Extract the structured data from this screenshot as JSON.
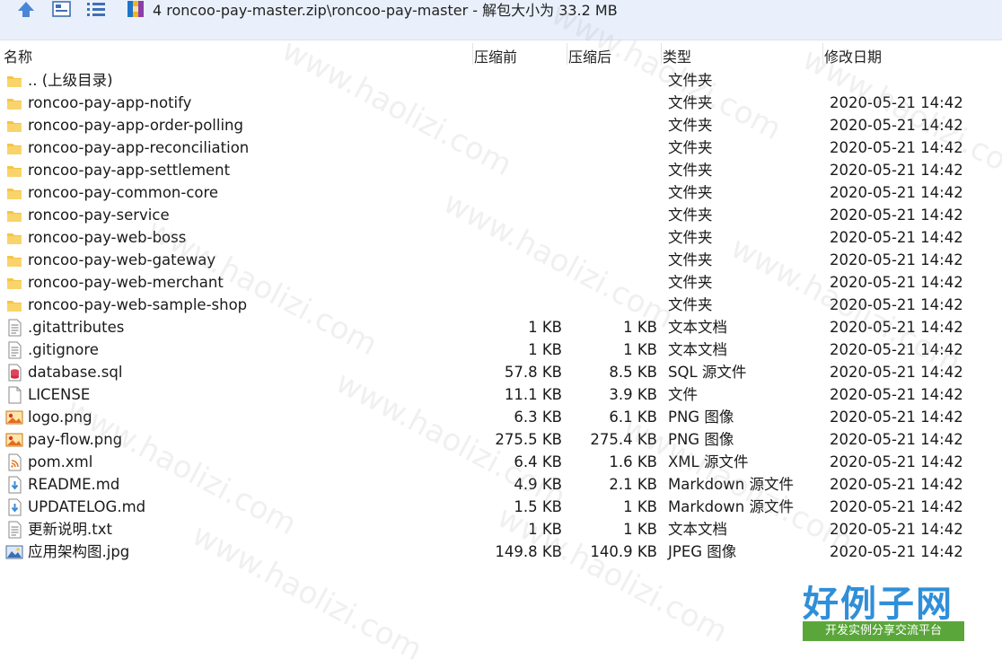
{
  "toolbar": {
    "path": "4 roncoo-pay-master.zip\\roncoo-pay-master - 解包大小为 33.2 MB"
  },
  "columns": {
    "name": "名称",
    "packed": "压缩前",
    "original": "压缩后",
    "type": "类型",
    "modified": "修改日期"
  },
  "files": [
    {
      "icon": "folder-icon",
      "name": ".. (上级目录)",
      "packed": "",
      "original": "",
      "type": "文件夹",
      "modified": ""
    },
    {
      "icon": "folder-icon",
      "name": "roncoo-pay-app-notify",
      "packed": "",
      "original": "",
      "type": "文件夹",
      "modified": "2020-05-21 14:42"
    },
    {
      "icon": "folder-icon",
      "name": "roncoo-pay-app-order-polling",
      "packed": "",
      "original": "",
      "type": "文件夹",
      "modified": "2020-05-21 14:42"
    },
    {
      "icon": "folder-icon",
      "name": "roncoo-pay-app-reconciliation",
      "packed": "",
      "original": "",
      "type": "文件夹",
      "modified": "2020-05-21 14:42"
    },
    {
      "icon": "folder-icon",
      "name": "roncoo-pay-app-settlement",
      "packed": "",
      "original": "",
      "type": "文件夹",
      "modified": "2020-05-21 14:42"
    },
    {
      "icon": "folder-icon",
      "name": "roncoo-pay-common-core",
      "packed": "",
      "original": "",
      "type": "文件夹",
      "modified": "2020-05-21 14:42"
    },
    {
      "icon": "folder-icon",
      "name": "roncoo-pay-service",
      "packed": "",
      "original": "",
      "type": "文件夹",
      "modified": "2020-05-21 14:42"
    },
    {
      "icon": "folder-icon",
      "name": "roncoo-pay-web-boss",
      "packed": "",
      "original": "",
      "type": "文件夹",
      "modified": "2020-05-21 14:42"
    },
    {
      "icon": "folder-icon",
      "name": "roncoo-pay-web-gateway",
      "packed": "",
      "original": "",
      "type": "文件夹",
      "modified": "2020-05-21 14:42"
    },
    {
      "icon": "folder-icon",
      "name": "roncoo-pay-web-merchant",
      "packed": "",
      "original": "",
      "type": "文件夹",
      "modified": "2020-05-21 14:42"
    },
    {
      "icon": "folder-icon",
      "name": "roncoo-pay-web-sample-shop",
      "packed": "",
      "original": "",
      "type": "文件夹",
      "modified": "2020-05-21 14:42"
    },
    {
      "icon": "text-file-icon",
      "name": ".gitattributes",
      "packed": "1 KB",
      "original": "1 KB",
      "type": "文本文档",
      "modified": "2020-05-21 14:42"
    },
    {
      "icon": "text-file-icon",
      "name": ".gitignore",
      "packed": "1 KB",
      "original": "1 KB",
      "type": "文本文档",
      "modified": "2020-05-21 14:42"
    },
    {
      "icon": "database-file-icon",
      "name": "database.sql",
      "packed": "57.8 KB",
      "original": "8.5 KB",
      "type": "SQL 源文件",
      "modified": "2020-05-21 14:42"
    },
    {
      "icon": "blank-file-icon",
      "name": "LICENSE",
      "packed": "11.1 KB",
      "original": "3.9 KB",
      "type": "文件",
      "modified": "2020-05-21 14:42"
    },
    {
      "icon": "image-file-icon",
      "name": "logo.png",
      "packed": "6.3 KB",
      "original": "6.1 KB",
      "type": "PNG 图像",
      "modified": "2020-05-21 14:42"
    },
    {
      "icon": "image-file-icon",
      "name": "pay-flow.png",
      "packed": "275.5 KB",
      "original": "275.4 KB",
      "type": "PNG 图像",
      "modified": "2020-05-21 14:42"
    },
    {
      "icon": "xml-file-icon",
      "name": "pom.xml",
      "packed": "6.4 KB",
      "original": "1.6 KB",
      "type": "XML 源文件",
      "modified": "2020-05-21 14:42"
    },
    {
      "icon": "markdown-file-icon",
      "name": "README.md",
      "packed": "4.9 KB",
      "original": "2.1 KB",
      "type": "Markdown 源文件",
      "modified": "2020-05-21 14:42"
    },
    {
      "icon": "markdown-file-icon",
      "name": "UPDATELOG.md",
      "packed": "1.5 KB",
      "original": "1 KB",
      "type": "Markdown 源文件",
      "modified": "2020-05-21 14:42"
    },
    {
      "icon": "text-file-icon",
      "name": "更新说明.txt",
      "packed": "1 KB",
      "original": "1 KB",
      "type": "文本文档",
      "modified": "2020-05-21 14:42"
    },
    {
      "icon": "jpeg-file-icon",
      "name": "应用架构图.jpg",
      "packed": "149.8 KB",
      "original": "140.9 KB",
      "type": "JPEG 图像",
      "modified": "2020-05-21 14:42"
    }
  ],
  "watermark": {
    "text": "www.haolizi.com"
  },
  "brand": {
    "title": "好例子网",
    "subtitle": "开发实例分享交流平台"
  },
  "colors": {
    "toolbar_bg": "#e9f0fb",
    "folder": "#f6c445",
    "accent": "#2f8fd8",
    "brand_green": "#5aa63a"
  }
}
